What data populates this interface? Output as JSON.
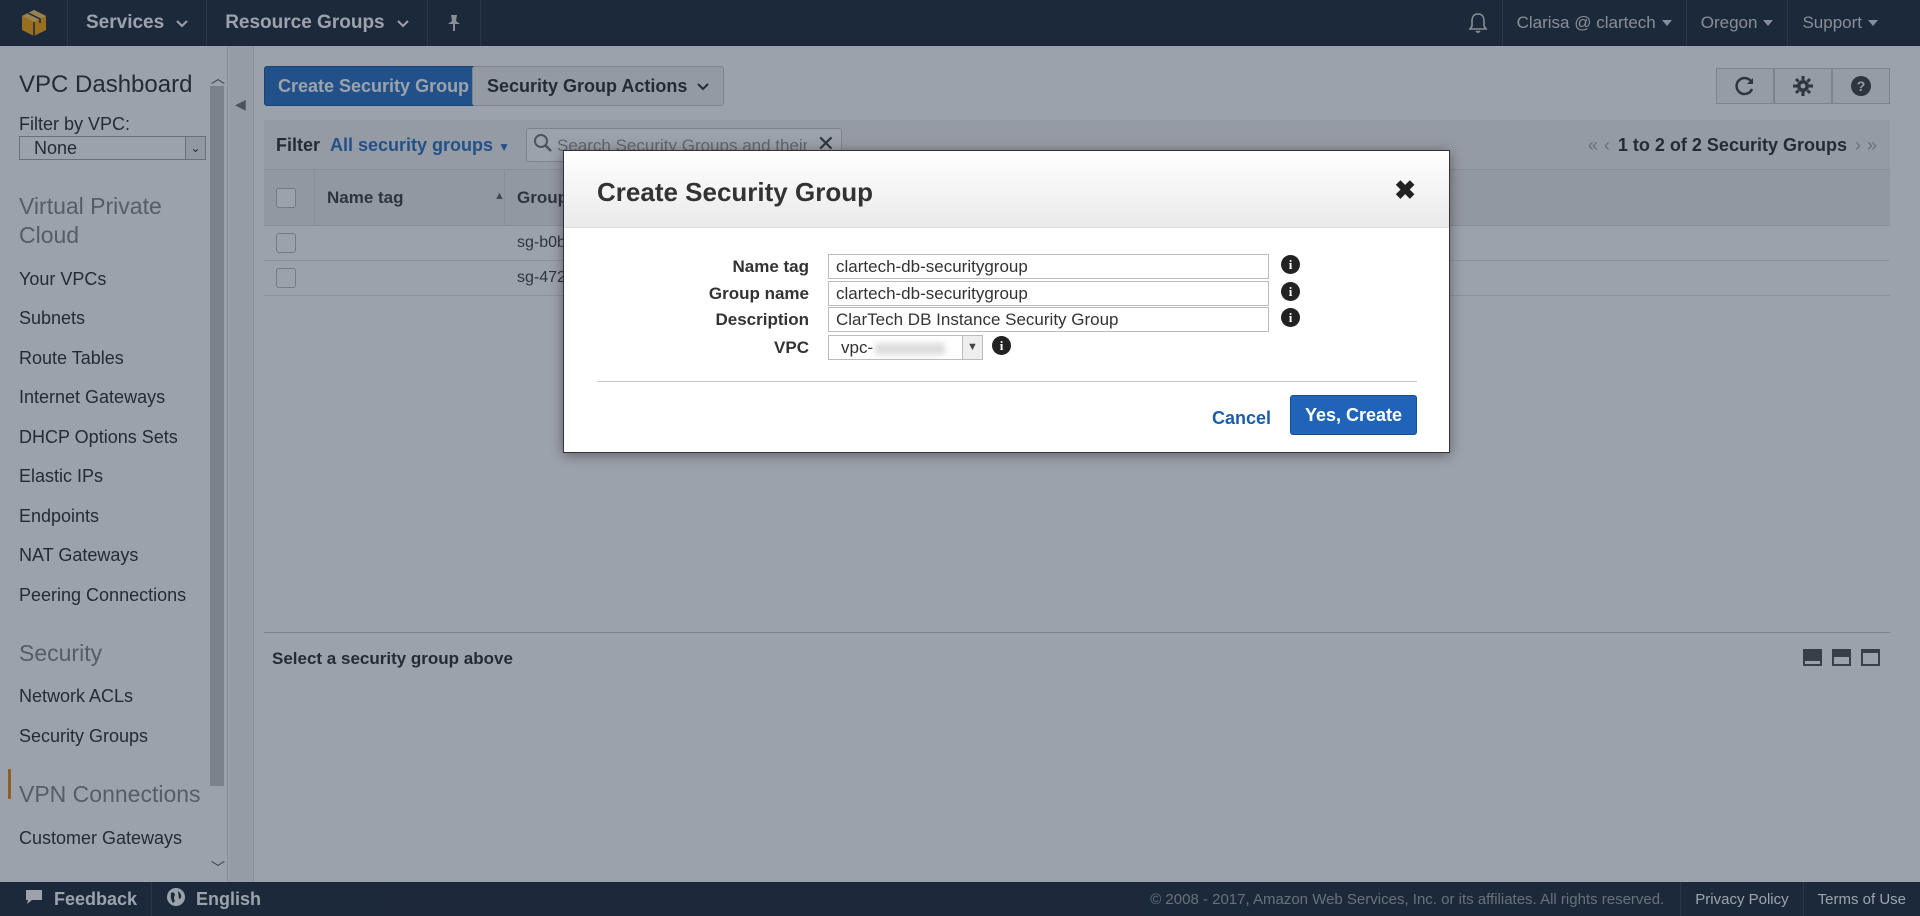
{
  "topnav": {
    "services": "Services",
    "resource_groups": "Resource Groups",
    "user": "Clarisa @ clartech",
    "region": "Oregon",
    "support": "Support"
  },
  "sidebar": {
    "title": "VPC Dashboard",
    "filter_label": "Filter by VPC:",
    "filter_value": "None",
    "sections": [
      {
        "title": "Virtual Private Cloud",
        "items": [
          "Your VPCs",
          "Subnets",
          "Route Tables",
          "Internet Gateways",
          "DHCP Options Sets",
          "Elastic IPs",
          "Endpoints",
          "NAT Gateways",
          "Peering Connections"
        ]
      },
      {
        "title": "Security",
        "items": [
          "Network ACLs",
          "Security Groups"
        ]
      },
      {
        "title": "VPN Connections",
        "items": [
          "Customer Gateways"
        ]
      }
    ],
    "active_item": "Security Groups"
  },
  "toolbar": {
    "create_label": "Create Security Group",
    "actions_label": "Security Group Actions"
  },
  "filter": {
    "label": "Filter",
    "selected": "All security groups",
    "search_placeholder": "Search Security Groups and their properties",
    "pager": "1 to 2 of 2 Security Groups"
  },
  "table": {
    "headers": [
      "Name tag",
      "Group"
    ],
    "rows": [
      {
        "name_tag": "",
        "group": "sg-b0b"
      },
      {
        "name_tag": "",
        "group": "sg-472"
      }
    ]
  },
  "detail": {
    "placeholder": "Select a security group above"
  },
  "footer": {
    "feedback": "Feedback",
    "language": "English",
    "copyright": "© 2008 - 2017, Amazon Web Services, Inc. or its affiliates. All rights reserved.",
    "privacy": "Privacy Policy",
    "terms": "Terms of Use"
  },
  "modal": {
    "title": "Create Security Group",
    "fields": {
      "name_tag_label": "Name tag",
      "name_tag_value": "clartech-db-securitygroup",
      "group_name_label": "Group name",
      "group_name_value": "clartech-db-securitygroup",
      "description_label": "Description",
      "description_value": "ClarTech DB Instance Security Group",
      "vpc_label": "VPC",
      "vpc_value": "vpc-"
    },
    "cancel_label": "Cancel",
    "create_label": "Yes, Create"
  },
  "colors": {
    "nav_bg": "#232f3e",
    "primary": "#2e74c4",
    "active_accent": "#e8891a"
  }
}
